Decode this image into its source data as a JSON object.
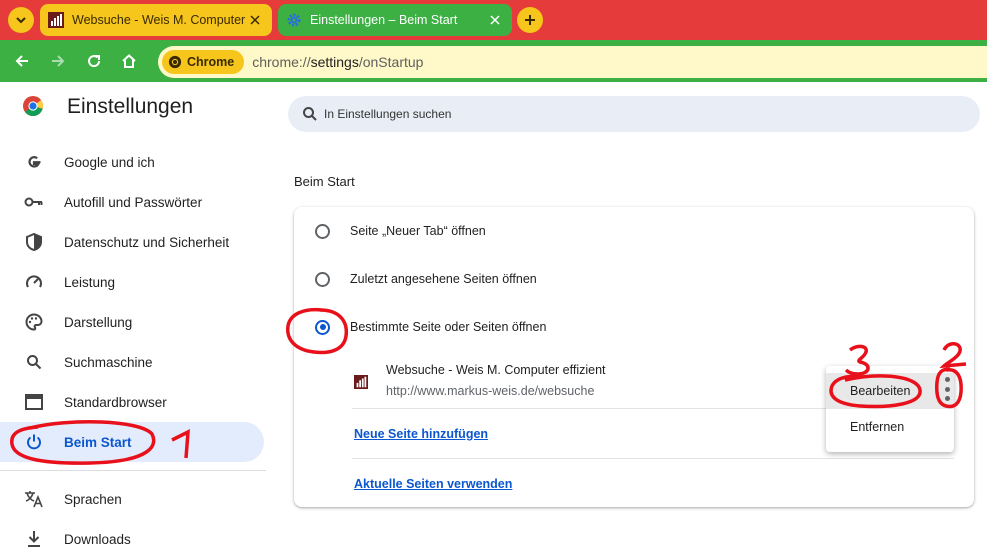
{
  "tabs": [
    {
      "title": "Websuche - Weis M. Computer",
      "active": false
    },
    {
      "title": "Einstellungen – Beim Start",
      "active": true
    }
  ],
  "toolbar": {
    "chip_label": "Chrome",
    "url_prefix": "chrome://",
    "url_path": "settings",
    "url_suffix": "/onStartup"
  },
  "header": {
    "title": "Einstellungen",
    "search_placeholder": "In Einstellungen suchen"
  },
  "sidebar": {
    "items": [
      {
        "label": "Google und ich",
        "icon": "google-g-icon"
      },
      {
        "label": "Autofill und Passwörter",
        "icon": "key-icon"
      },
      {
        "label": "Datenschutz und Sicherheit",
        "icon": "shield-icon"
      },
      {
        "label": "Leistung",
        "icon": "gauge-icon"
      },
      {
        "label": "Darstellung",
        "icon": "palette-icon"
      },
      {
        "label": "Suchmaschine",
        "icon": "search-icon"
      },
      {
        "label": "Standardbrowser",
        "icon": "browser-window-icon"
      },
      {
        "label": "Beim Start",
        "icon": "power-icon",
        "active": true
      },
      {
        "label": "Sprachen",
        "icon": "translate-icon"
      },
      {
        "label": "Downloads",
        "icon": "download-icon"
      }
    ]
  },
  "main": {
    "section_title": "Beim Start",
    "options": [
      {
        "label": "Seite „Neuer Tab“ öffnen",
        "checked": false
      },
      {
        "label": "Zuletzt angesehene Seiten öffnen",
        "checked": false
      },
      {
        "label": "Bestimmte Seite oder Seiten öffnen",
        "checked": true
      }
    ],
    "page_entry": {
      "name": "Websuche - Weis M. Computer effizient",
      "url": "http://www.markus-weis.de/websuche"
    },
    "add_link": "Neue Seite hinzufügen",
    "use_current_link": "Aktuelle Seiten verwenden"
  },
  "context_menu": {
    "items": [
      "Bearbeiten",
      "Entfernen"
    ]
  },
  "annotations": [
    "1",
    "2",
    "3"
  ],
  "colors": {
    "tabstrip": "#e53b3b",
    "toolbar": "#3cb043",
    "accent": "#0b57d0",
    "annotation": "#e8101a"
  }
}
